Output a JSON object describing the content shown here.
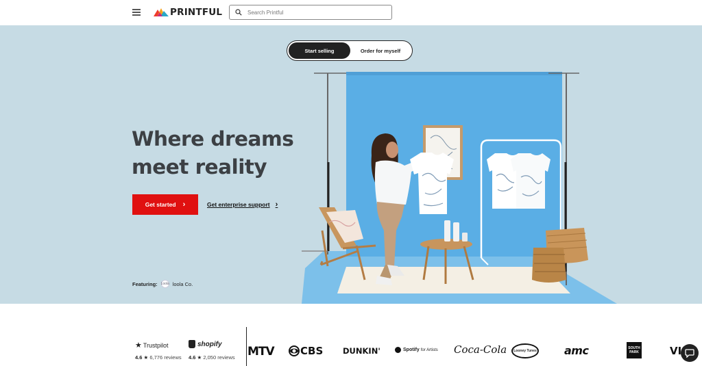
{
  "header": {
    "logo_text": "PRINTFUL",
    "search_placeholder": "Search Printful"
  },
  "hero": {
    "toggle": {
      "active_label": "Start selling",
      "inactive_label": "Order for myself"
    },
    "headline_line1": "Where dreams",
    "headline_line2": "meet reality",
    "cta_label": "Get started",
    "secondary_link": "Get enterprise support",
    "featuring_label": "Featuring:",
    "featuring_brand": "loola Co.",
    "featuring_avatar": "Loola"
  },
  "ratings": {
    "trustpilot": {
      "name": "Trustpilot",
      "score": "4.6",
      "reviews": "6,776 reviews"
    },
    "shopify": {
      "name": "shopify",
      "score": "4.6",
      "reviews": "2,050 reviews"
    }
  },
  "brands": {
    "mtv": "MTV",
    "cbs": "CBS",
    "dunkin": "DUNKIN'",
    "spotify": "Spotify",
    "spotify_sub": "for Artists",
    "cocacola": "Coca-Cola",
    "looney": "Looney Tunes",
    "amc": "amc",
    "southpark_1": "SOUTH",
    "southpark_2": "PARK",
    "viacom": "VI"
  },
  "colors": {
    "hero_bg": "#c6dbe4",
    "backdrop_blue": "#5aaee5",
    "cta_red": "#e01010",
    "headline": "#3c4044"
  }
}
